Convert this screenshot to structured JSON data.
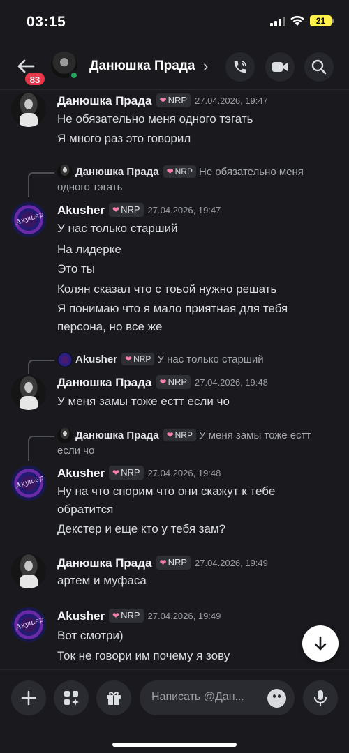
{
  "status_bar": {
    "time": "03:15",
    "battery": "21"
  },
  "header": {
    "unread_badge": "83",
    "title": "Данюшка Прада",
    "chevron": "›",
    "icons": [
      "phone-call-icon",
      "video-camera-icon",
      "search-icon"
    ]
  },
  "messages": [
    {
      "author": "Данюшка Прада",
      "tag": "NRP",
      "timestamp": "27.04.2026, 19:47",
      "lines": [
        "Не обязательно меня одного тэгать",
        "Я много раз это говорил"
      ]
    },
    {
      "reply": {
        "author": "Данюшка Прада",
        "tag": "NRP",
        "text": "Не обязательно меня одного тэгать"
      },
      "author": "Akusher",
      "tag": "NRP",
      "timestamp": "27.04.2026, 19:47",
      "lines": [
        "У нас только старший",
        "На лидерке",
        "Это ты",
        "Колян сказал что с тоьой нужно решать",
        "Я понимаю что я мало приятная для тебя",
        "персона, но все же"
      ]
    },
    {
      "reply": {
        "author": "Akusher",
        "tag": "NRP",
        "text": "У нас только старший"
      },
      "author": "Данюшка Прада",
      "tag": "NRP",
      "timestamp": "27.04.2026, 19:48",
      "lines": [
        "У меня замы тоже естт  если чо"
      ]
    },
    {
      "reply": {
        "author": "Данюшка Прада",
        "tag": "NRP",
        "text": "У меня замы тоже естт если чо"
      },
      "author": "Akusher",
      "tag": "NRP",
      "timestamp": "27.04.2026, 19:48",
      "lines": [
        "Ну на что спорим что они скажут к тебе",
        "обратится",
        "Декстер и еще кто у тебя зам?"
      ]
    },
    {
      "author": "Данюшка Прада",
      "tag": "NRP",
      "timestamp": "27.04.2026, 19:49",
      "lines": [
        "артем и муфаса"
      ]
    },
    {
      "author": "Akusher",
      "tag": "NRP",
      "timestamp": "27.04.2026, 19:49",
      "lines": [
        "Вот смотри)",
        "Ток не говори им почему я зову"
      ]
    }
  ],
  "composer": {
    "placeholder": "Написать @Дан..."
  },
  "colors": {
    "background": "#1a1a1e",
    "badge": "#e8364a",
    "online": "#23a55a",
    "tag_heart": "#f47fa8"
  }
}
